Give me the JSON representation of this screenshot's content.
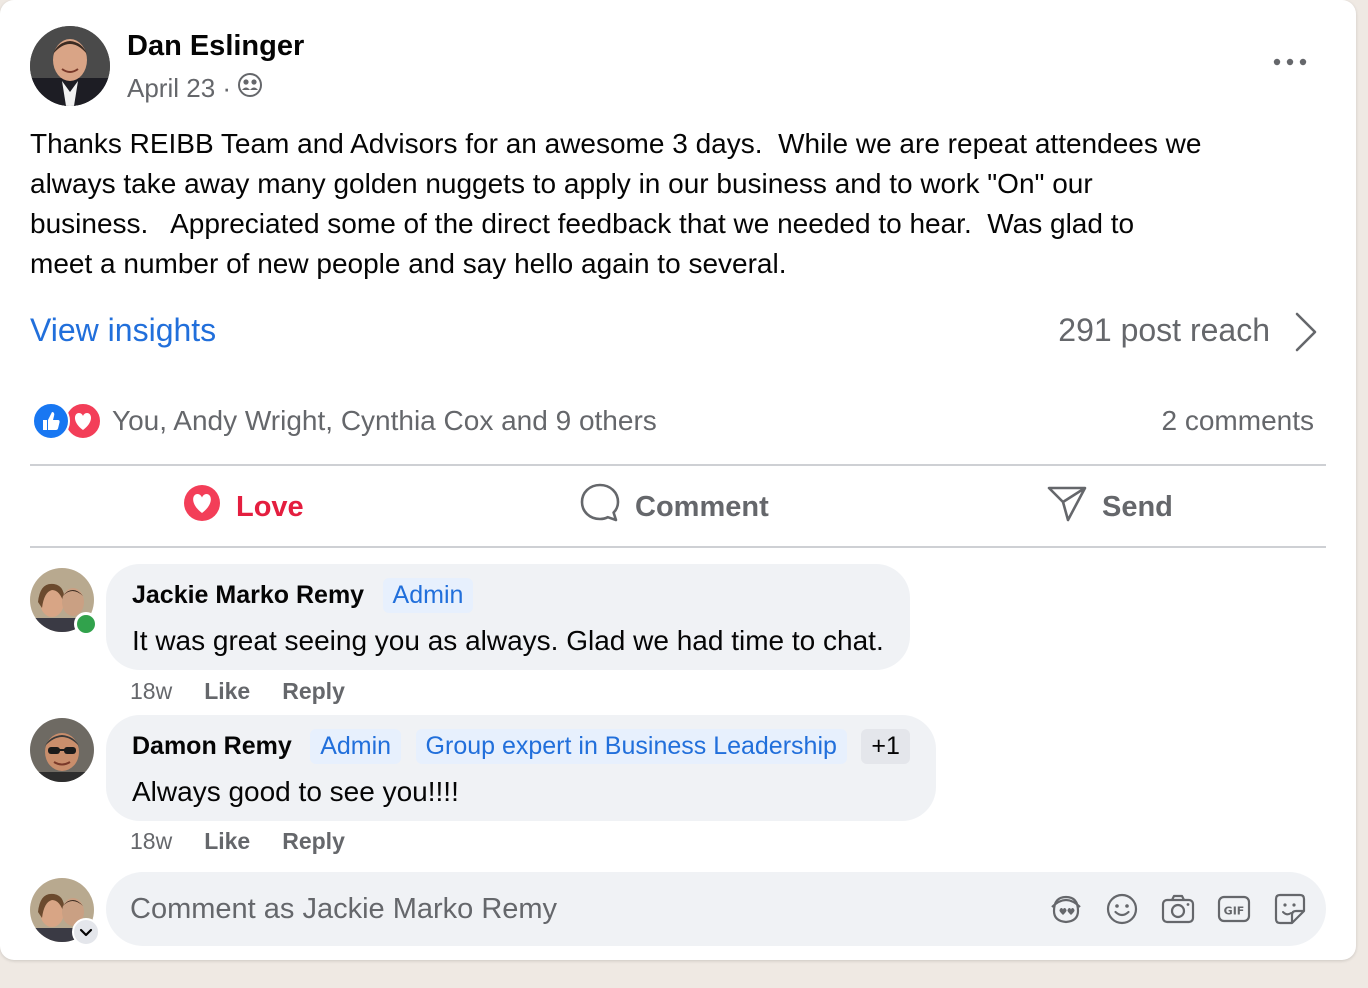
{
  "post": {
    "author": "Dan Eslinger",
    "date": "April 23 ·",
    "privacy_icon": "group-icon",
    "body": "Thanks REIBB Team and Advisors for an awesome 3 days.  While we are repeat attendees we\nalways take away many golden nuggets to apply in our business and to work \"On\" our\nbusiness.   Appreciated some of the direct feedback that we needed to hear.  Was glad to\nmeet a number of new people and say hello again to several.",
    "view_insights": "View insights",
    "reach": "291 post reach",
    "reactions_text": "You, Andy Wright, Cynthia Cox and 9 others",
    "comments_count": "2 comments"
  },
  "actions": {
    "love": "Love",
    "comment": "Comment",
    "send": "Send"
  },
  "comments": [
    {
      "name": "Jackie Marko Remy",
      "badges": [
        "Admin"
      ],
      "text": "It was great seeing you as always. Glad we had time to chat.",
      "time": "18w",
      "like": "Like",
      "reply": "Reply"
    },
    {
      "name": "Damon Remy",
      "badges": [
        "Admin",
        "Group expert in Business Leadership",
        "+1"
      ],
      "text": "Always good to see you!!!!",
      "time": "18w",
      "like": "Like",
      "reply": "Reply"
    }
  ],
  "composer": {
    "placeholder": "Comment as Jackie Marko Remy",
    "tools": [
      "avatar-sticker-icon",
      "emoji-icon",
      "camera-icon",
      "gif-icon",
      "sticker-icon"
    ]
  },
  "colors": {
    "link_blue": "#216fdb",
    "love_red": "#e41e3f",
    "like_blue": "#1877f2",
    "muted": "#65676b",
    "bubble": "#f0f2f5"
  }
}
